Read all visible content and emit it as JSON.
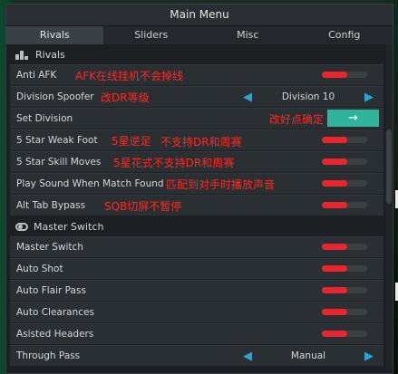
{
  "window": {
    "title": "Main Menu"
  },
  "tabs": [
    {
      "label": "Rivals",
      "active": true
    },
    {
      "label": "Sliders",
      "active": false
    },
    {
      "label": "Misc",
      "active": false
    },
    {
      "label": "Config",
      "active": false
    }
  ],
  "sections": {
    "rivals": "Rivals",
    "master": "Master Switch"
  },
  "rows": {
    "anti_afk": "Anti AFK",
    "division_spoofer": "Division Spoofer",
    "division_value": "Division 10",
    "set_division": "Set Division",
    "five_star_weak_foot": "5 Star Weak Foot",
    "five_star_skill_moves": "5 Star Skill Moves",
    "play_sound": "Play Sound When Match Found",
    "alt_tab": "Alt Tab Bypass",
    "master_switch": "Master Switch",
    "auto_shot": "Auto Shot",
    "auto_flair_pass": "Auto Flair Pass",
    "auto_clearances": "Auto Clearances",
    "asisted_headers": "Asisted Headers",
    "through_pass": "Through Pass",
    "through_pass_value": "Manual"
  },
  "annotations": {
    "anti_afk": "AFK在线挂机不会掉线",
    "division": "改DR等级",
    "set_division": "改好点确定",
    "weak_foot_a": "5星逆足",
    "weak_foot_b": "不支持DR和周赛",
    "skill_moves": "5星花式不支持DR和周赛",
    "play_sound": "匹配到对手时播放声音",
    "alt_tab": "SQB切屏不暂停"
  },
  "icons": {
    "left_arrow": "◀",
    "right_arrow": "▶",
    "confirm_arrow": "→"
  },
  "colors": {
    "accent_blue": "#2aa3d9",
    "toggle_red": "#e8262b",
    "button_teal": "#2fb39a",
    "annotation_red": "#ff2a1e"
  }
}
